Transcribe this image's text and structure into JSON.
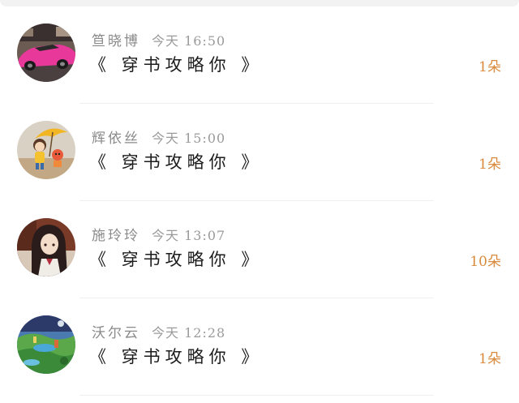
{
  "items": [
    {
      "name": "笪晓博",
      "time": "今天 16:50",
      "message": "《 穿书攻略你 》",
      "count": "1朵",
      "avatar_icon": "pink-sports-car-avatar"
    },
    {
      "name": "辉依丝",
      "time": "今天 15:00",
      "message": "《 穿书攻略你 》",
      "count": "1朵",
      "avatar_icon": "cartoon-girl-umbrella-avatar"
    },
    {
      "name": "施玲玲",
      "time": "今天 13:07",
      "message": "《 穿书攻略你 》",
      "count": "10朵",
      "avatar_icon": "anime-girl-avatar"
    },
    {
      "name": "沃尔云",
      "time": "今天 12:28",
      "message": "《 穿书攻略你 》",
      "count": "1朵",
      "avatar_icon": "fantasy-landscape-avatar"
    }
  ],
  "colors": {
    "count": "#d98a3c",
    "name": "#8a8a8a",
    "message": "#1c1c1c"
  }
}
